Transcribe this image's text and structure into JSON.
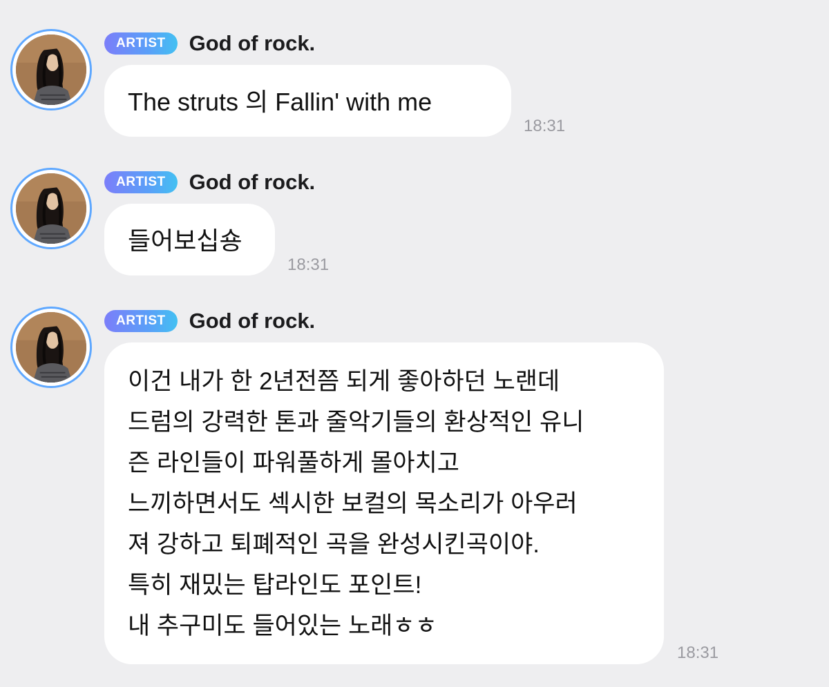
{
  "messages": [
    {
      "badge": "ARTIST",
      "sender": "God of rock.",
      "text": "The struts 의 Fallin' with me",
      "time": "18:31",
      "avatar_icon": "artist-avatar"
    },
    {
      "badge": "ARTIST",
      "sender": "God of rock.",
      "text": "들어보십숑",
      "time": "18:31",
      "avatar_icon": "artist-avatar"
    },
    {
      "badge": "ARTIST",
      "sender": "God of rock.",
      "text": "이건 내가 한 2년전쯤 되게 좋아하던 노랜데\n드럼의 강력한 톤과 줄악기들의 환상적인 유니\n즌 라인들이 파워풀하게 몰아치고\n느끼하면서도 섹시한 보컬의 목소리가 아우러\n져 강하고 퇴폐적인 곡을 완성시킨곡이야.\n특히 재밌는 탑라인도 포인트!\n내 추구미도 들어있는 노래ㅎㅎ",
      "time": "18:31",
      "avatar_icon": "artist-avatar"
    }
  ],
  "colors": {
    "background": "#eeeef0",
    "bubble": "#ffffff",
    "avatar_ring": "#5fa8ff",
    "badge_gradient_start": "#7b7ef9",
    "badge_gradient_end": "#43c0f2",
    "time": "#9a9aa0"
  }
}
